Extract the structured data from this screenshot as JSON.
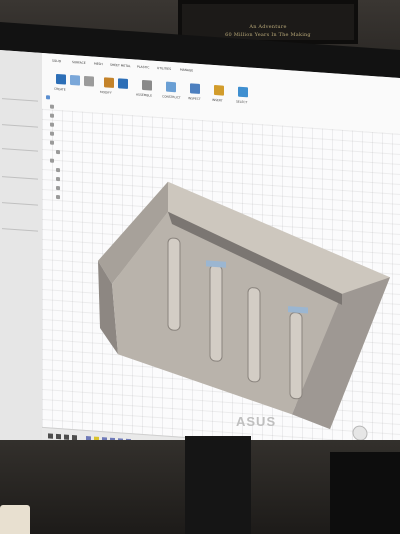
{
  "poster": {
    "line1": "An Adventure",
    "line2": "60 Million Years In The Making"
  },
  "monitor": {
    "brand": "ASUS"
  },
  "app": {
    "toolbar_tabs": [
      "SOLID",
      "SURFACE",
      "MESH",
      "SHEET METAL",
      "PLASTIC",
      "UTILITIES",
      "MANAGE"
    ],
    "toolbar_groups": [
      "CREATE",
      "MODIFY",
      "ASSEMBLE",
      "CONSTRUCT",
      "INSPECT",
      "INSERT",
      "SELECT"
    ]
  },
  "colors": {
    "screen": "#f3f4f6",
    "accent_blue": "#2d6fb7",
    "model_top": "#c8c1b6",
    "model_side": "#9b9590",
    "model_dark": "#6f6b67"
  }
}
